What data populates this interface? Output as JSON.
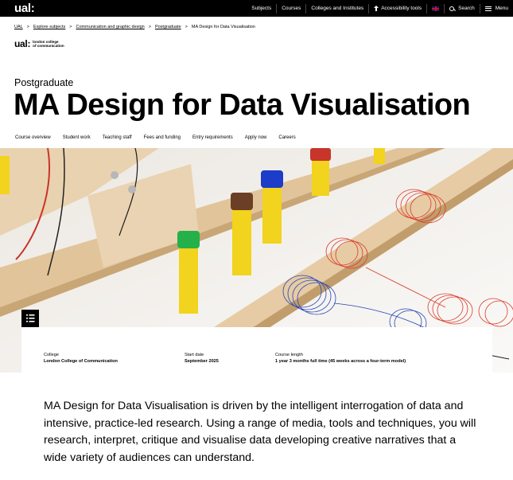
{
  "topbar": {
    "logo": "ual:",
    "nav": [
      {
        "label": "Subjects"
      },
      {
        "label": "Courses"
      },
      {
        "label": "Colleges and Institutes"
      },
      {
        "label": "Accessibility tools",
        "icon": "accessibility-arrow-icon"
      },
      {
        "label": "",
        "icon": "uk-flag-icon"
      },
      {
        "label": "Search",
        "icon": "search-icon"
      },
      {
        "label": "Menu",
        "icon": "menu-icon"
      }
    ]
  },
  "breadcrumb": {
    "items": [
      "UAL",
      "Explore subjects",
      "Communication and graphic design",
      "Postgraduate"
    ],
    "current": "MA Design for Data Visualisation",
    "separator": ">"
  },
  "college": {
    "mark": "ual:",
    "line1": "london college",
    "line2": "of communication"
  },
  "page": {
    "kicker": "Postgraduate",
    "title": "MA Design for Data Visualisation"
  },
  "course_nav": [
    "Course overview",
    "Student work",
    "Teaching staff",
    "Fees and funding",
    "Entry requirements",
    "Apply now",
    "Careers"
  ],
  "facts": {
    "college": {
      "label": "College",
      "value": "London College of Communication"
    },
    "start": {
      "label": "Start date",
      "value": "September 2025"
    },
    "length": {
      "label": "Course length",
      "value": "1 year 3 months full time (45 weeks across a four-term model)"
    }
  },
  "intro": "MA Design for Data Visualisation is driven by the intelligent interrogation of data and intensive, practice-led research. Using a range of media, tools and techniques, you will research, interpret, critique and visualise data developing creative narratives that a wide variety of audiences can understand.",
  "hero": {
    "alt_icon": "table-of-contents-icon",
    "colors": {
      "wood": "#e2c49a",
      "pen_yellow": "#f2d31d",
      "red_coil": "#d93a2b",
      "blue_coil": "#2746b8",
      "green_cap": "#24b14a",
      "blue_cap": "#1c3cc9",
      "brown_cap": "#6b3f25"
    }
  }
}
